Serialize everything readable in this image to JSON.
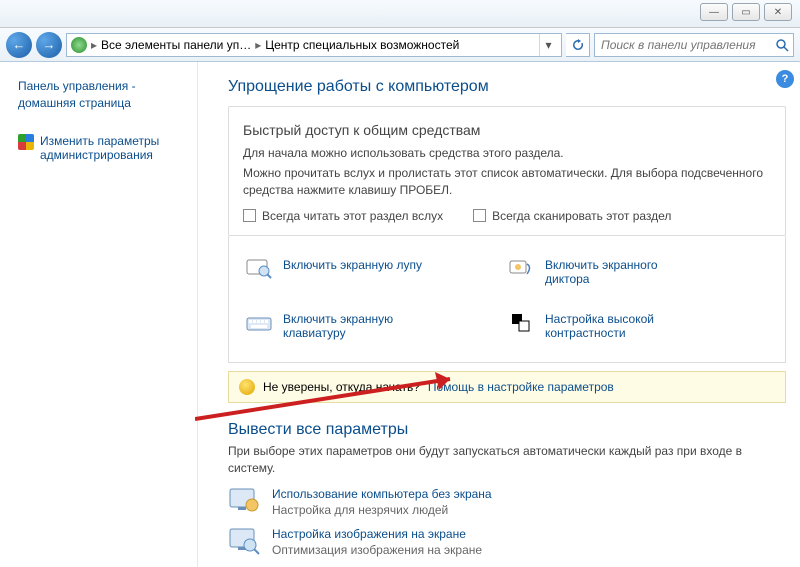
{
  "titlebar": {
    "min": "—",
    "max": "▭",
    "close": "✕"
  },
  "nav": {
    "back": "←",
    "forward": "→",
    "crumb1": "Все элементы панели уп…",
    "crumb2": "Центр специальных возможностей",
    "search_placeholder": "Поиск в панели управления"
  },
  "sidebar": {
    "home1": "Панель управления -",
    "home2": "домашняя страница",
    "adminLink1": "Изменить параметры",
    "adminLink2": "администрирования"
  },
  "main": {
    "h1": "Упрощение работы с компьютером",
    "quick_title": "Быстрый доступ к общим средствам",
    "quick_p1": "Для начала можно использовать средства этого раздела.",
    "quick_p2": "Можно прочитать вслух и пролистать этот список автоматически. Для выбора подсвеченного средства нажмите клавишу ПРОБЕЛ.",
    "chk_read": "Всегда читать этот раздел вслух",
    "chk_scan": "Всегда сканировать этот раздел",
    "tools": {
      "magnifier": "Включить экранную лупу",
      "narrator1": "Включить экранного",
      "narrator2": "диктора",
      "osk1": "Включить экранную",
      "osk2": "клавиатуру",
      "contrast1": "Настройка высокой",
      "contrast2": "контрастности"
    },
    "info_q": "Не уверены, откуда начать?",
    "info_link": "Помощь в настройке параметров",
    "h2": "Вывести все параметры",
    "h2_sub": "При выборе этих параметров они будут запускаться автоматически каждый раз при входе в систему.",
    "p1_link": "Использование компьютера без экрана",
    "p1_sub": "Настройка для незрячих людей",
    "p2_link": "Настройка изображения на экране",
    "p2_sub": "Оптимизация изображения на экране"
  }
}
